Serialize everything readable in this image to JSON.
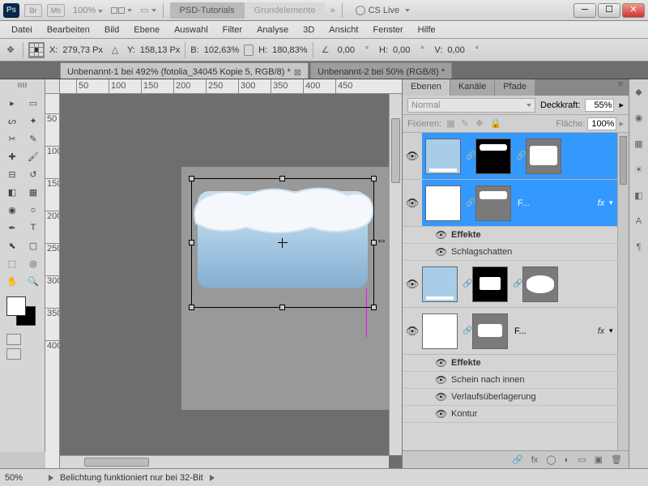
{
  "titlebar": {
    "ps_label": "Ps",
    "br_label": "Br",
    "mb_label": "Mb",
    "zoom": "100%",
    "tab1": "PSD-Tutorials",
    "tab2": "Grundelemente",
    "cslive": "CS Live"
  },
  "menu": [
    "Datei",
    "Bearbeiten",
    "Bild",
    "Ebene",
    "Auswahl",
    "Filter",
    "Analyse",
    "3D",
    "Ansicht",
    "Fenster",
    "Hilfe"
  ],
  "options": {
    "x_label": "X:",
    "x": "279,73 Px",
    "y_label": "Y:",
    "y": "158,13 Px",
    "w_label": "B:",
    "w": "102,63%",
    "h_label": "H:",
    "h": "180,83%",
    "angle_label": "",
    "angle": "0,00",
    "skew_h_label": "H:",
    "skew_h": "0,00",
    "skew_v_label": "V:",
    "skew_v": "0,00"
  },
  "doc_tabs": {
    "tab1": "Unbenannt-1 bei 492% (fotolia_34045 Kopie 5, RGB/8) *",
    "tab2": "Unbenannt-2 bei 50% (RGB/8) *"
  },
  "ruler_h": [
    "50",
    "100",
    "150",
    "200",
    "250",
    "300",
    "350",
    "400",
    "450"
  ],
  "ruler_v": [
    "50",
    "100",
    "150",
    "200",
    "250",
    "300",
    "350",
    "400"
  ],
  "layers_panel": {
    "tabs": [
      "Ebenen",
      "Kanäle",
      "Pfade"
    ],
    "blend_mode": "Normal",
    "opacity_label": "Deckkraft:",
    "opacity": "55%",
    "lock_label": "Fixieren:",
    "fill_label": "Fläche:",
    "fill": "100%",
    "layers": [
      {
        "name": "",
        "fx": ""
      },
      {
        "name": "F...",
        "fx": "fx"
      },
      {
        "fx_header": "Effekte",
        "sub": [
          "Schlagschatten"
        ]
      },
      {
        "name": "",
        "fx": ""
      },
      {
        "name": "F...",
        "fx": "fx"
      },
      {
        "fx_header": "Effekte",
        "sub": [
          "Schein nach innen",
          "Verlaufsüberlagerung",
          "Kontur"
        ]
      }
    ]
  },
  "statusbar": {
    "zoom": "50%",
    "msg": "Belichtung funktioniert nur bei 32-Bit"
  }
}
